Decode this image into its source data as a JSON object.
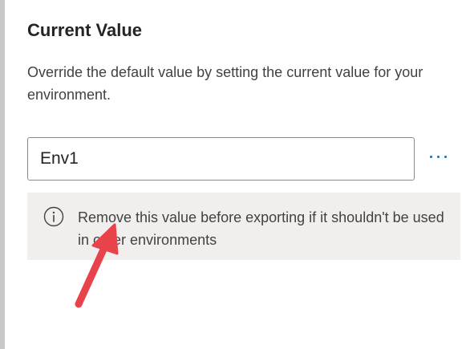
{
  "panel": {
    "title": "Current Value",
    "description": "Override the default value by setting the current value for your environment.",
    "value": "Env1",
    "more_icon": "more-horizontal-icon",
    "info": {
      "icon": "info-icon",
      "message": "Remove this value before exporting if it shouldn't be used in other environments"
    }
  },
  "colors": {
    "accent": "#0f6cbd",
    "banner_bg": "#f0efee",
    "annotation_arrow": "#e8434b"
  }
}
